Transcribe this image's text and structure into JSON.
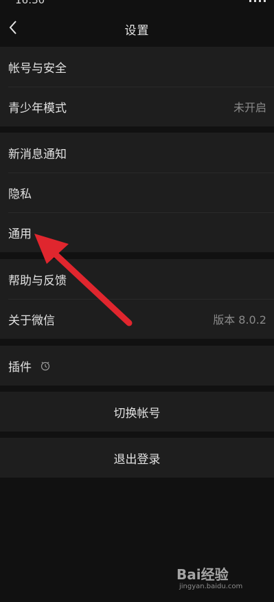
{
  "status": {
    "time": "16:30"
  },
  "header": {
    "title": "设置",
    "back_icon": "chevron-left-icon"
  },
  "groups": [
    {
      "items": [
        {
          "label": "帐号与安全",
          "value": ""
        },
        {
          "label": "青少年模式",
          "value": "未开启"
        }
      ]
    },
    {
      "items": [
        {
          "label": "新消息通知",
          "value": ""
        },
        {
          "label": "隐私",
          "value": ""
        },
        {
          "label": "通用",
          "value": ""
        }
      ]
    },
    {
      "items": [
        {
          "label": "帮助与反馈",
          "value": ""
        },
        {
          "label": "关于微信",
          "value": "版本 8.0.2"
        }
      ]
    },
    {
      "items": [
        {
          "label": "插件",
          "value": "",
          "icon": "plugin-icon"
        }
      ]
    }
  ],
  "actions": {
    "switch_account": "切换帐号",
    "logout": "退出登录"
  },
  "annotation": {
    "arrow_color": "#e0262e"
  },
  "watermark": {
    "brand": "Bai经验",
    "url": "jingyan.baidu.com"
  },
  "colors": {
    "background": "#111111",
    "row_background": "#1e1e1e",
    "text": "#e2e2e2",
    "secondary_text": "#8a8a8a"
  }
}
